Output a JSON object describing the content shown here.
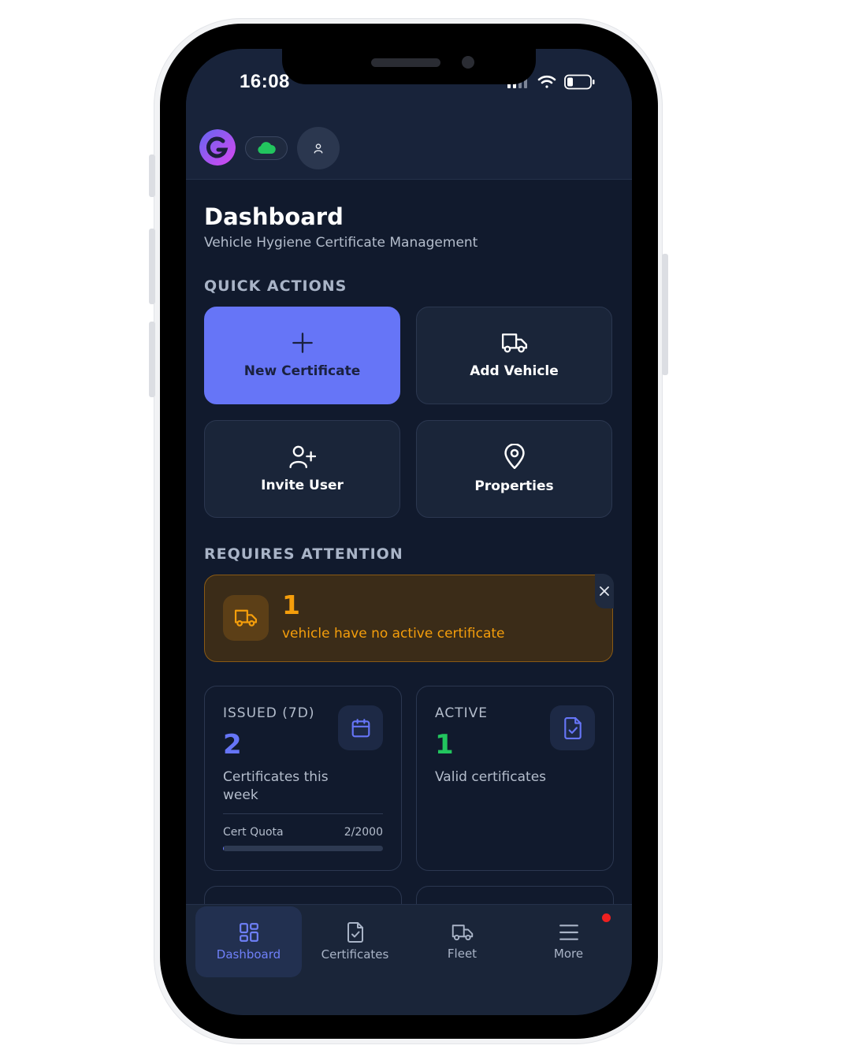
{
  "status_bar": {
    "time": "16:08"
  },
  "page": {
    "title": "Dashboard",
    "subtitle": "Vehicle Hygiene Certificate Management"
  },
  "quick_actions": {
    "label": "QUICK ACTIONS",
    "items": [
      {
        "label": "New Certificate",
        "icon": "plus-icon"
      },
      {
        "label": "Add Vehicle",
        "icon": "truck-icon"
      },
      {
        "label": "Invite User",
        "icon": "user-plus-icon"
      },
      {
        "label": "Properties",
        "icon": "map-pin-icon"
      }
    ]
  },
  "attention": {
    "label": "REQUIRES ATTENTION",
    "count": "1",
    "text": "vehicle have no active certificate"
  },
  "stats": {
    "issued": {
      "label": "ISSUED (7D)",
      "value": "2",
      "desc": "Certificates this week",
      "quota_label": "Cert Quota",
      "quota_value": "2/2000",
      "quota_fraction": 0.001
    },
    "active": {
      "label": "ACTIVE",
      "value": "1",
      "desc": "Valid certificates"
    }
  },
  "nav": {
    "items": [
      {
        "label": "Dashboard",
        "icon": "dashboard-grid-icon",
        "active": true
      },
      {
        "label": "Certificates",
        "icon": "file-check-icon",
        "active": false
      },
      {
        "label": "Fleet",
        "icon": "truck-icon",
        "active": false
      },
      {
        "label": "More",
        "icon": "menu-icon",
        "active": false
      }
    ]
  },
  "colors": {
    "accent": "#6675f7",
    "warning": "#f59e0b",
    "success": "#22c55e",
    "background": "#111a2d",
    "notification": "#ef2020"
  }
}
